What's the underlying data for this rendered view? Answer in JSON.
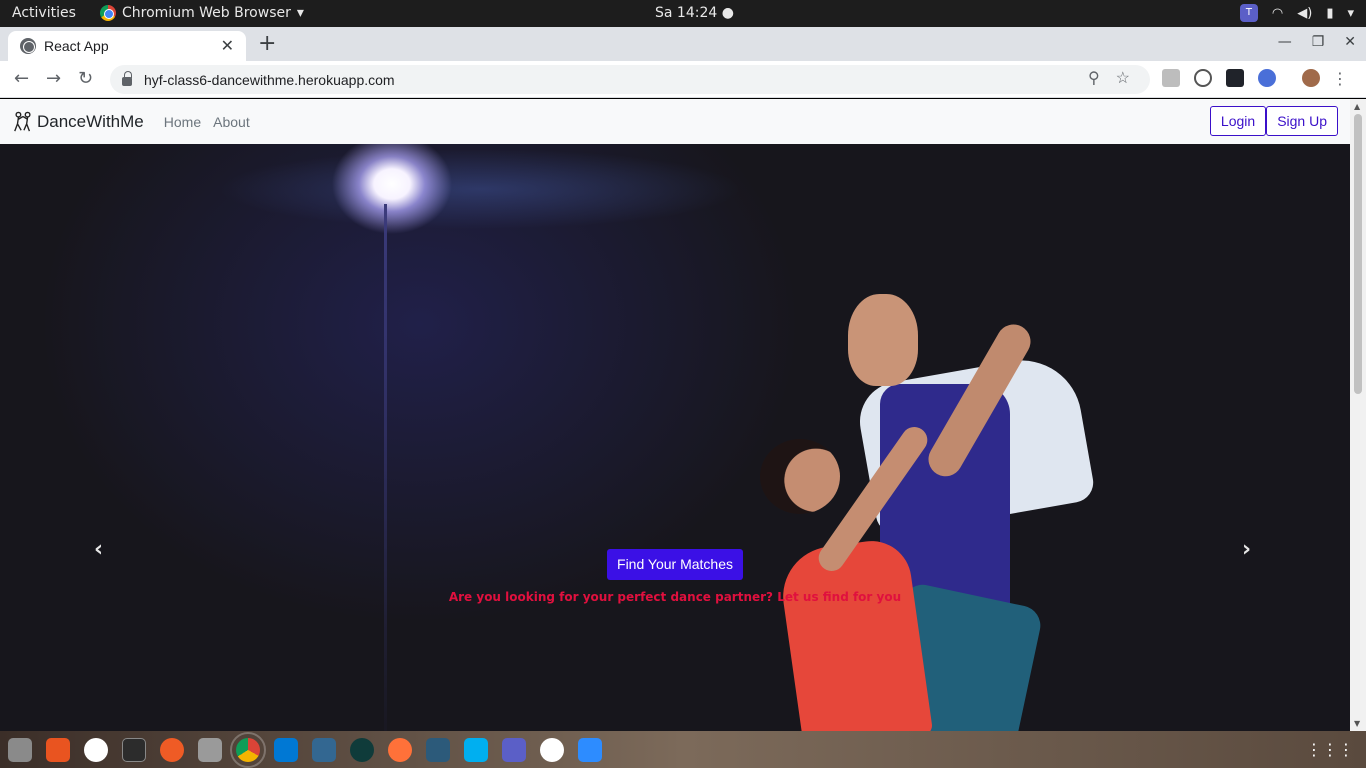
{
  "system": {
    "activities": "Activities",
    "app_name": "Chromium Web Browser",
    "clock": "Sa 14:24"
  },
  "browser": {
    "tab_title": "React App",
    "url": "hyf-class6-dancewithme.herokuapp.com"
  },
  "navbar": {
    "brand": "DanceWithMe",
    "links": [
      "Home",
      "About"
    ],
    "login": "Login",
    "signup": "Sign Up"
  },
  "hero": {
    "cta": "Find Your Matches",
    "tagline": "Are you looking for your perfect dance partner? Let us find for you"
  },
  "colors": {
    "accent": "#3b10e6",
    "tagline": "#e0103e",
    "navbar_bg": "#f8f9fa"
  },
  "dock": [
    "files",
    "software-center",
    "slack",
    "terminal",
    "postman",
    "scanner",
    "chromium",
    "vscode",
    "postgres",
    "gitkraken",
    "firefox",
    "mysql-workbench",
    "skype",
    "teams",
    "mongodb-compass",
    "zoom"
  ]
}
